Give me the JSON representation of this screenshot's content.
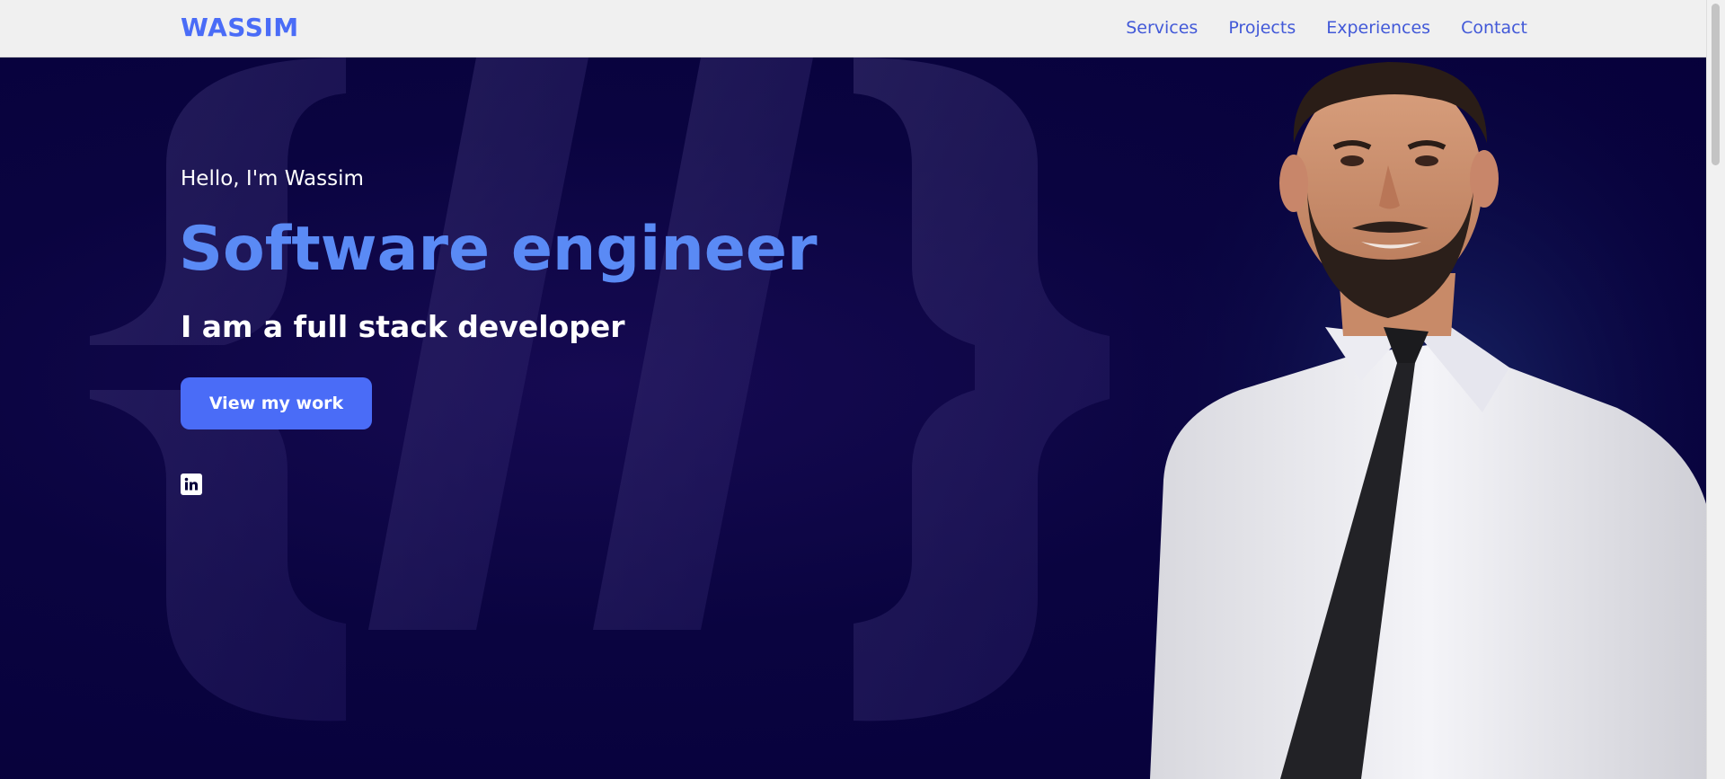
{
  "header": {
    "logo": "WASSIM",
    "nav": [
      {
        "label": "Services"
      },
      {
        "label": "Projects"
      },
      {
        "label": "Experiences"
      },
      {
        "label": "Contact"
      }
    ]
  },
  "hero": {
    "greeting": "Hello, I'm Wassim",
    "headline": "Software engineer",
    "subtitle": "I am a full stack developer",
    "cta_label": "View my work",
    "social_icon": "linkedin-icon"
  },
  "colors": {
    "accent": "#4a6cf7",
    "headline": "#5a8af5",
    "hero_bg": "#06003a",
    "navbar_bg": "#f0f0f0"
  }
}
